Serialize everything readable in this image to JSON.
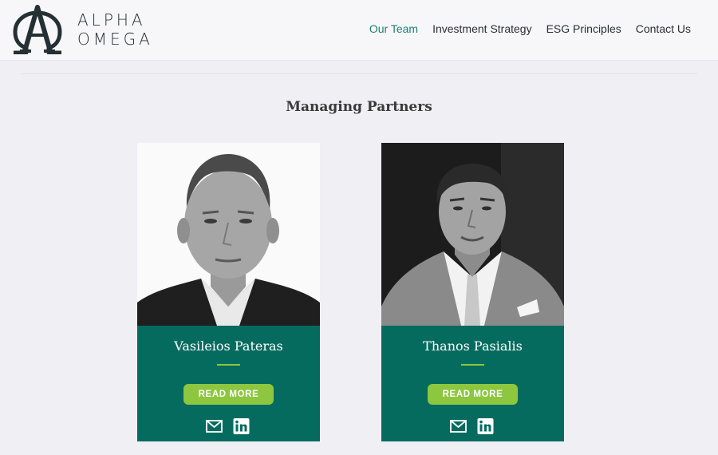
{
  "brand": {
    "line1": "ALPHA",
    "line2": "OMEGA"
  },
  "nav": {
    "items": [
      {
        "label": "Our Team",
        "active": true
      },
      {
        "label": "Investment Strategy",
        "active": false
      },
      {
        "label": "ESG Principles",
        "active": false
      },
      {
        "label": "Contact Us",
        "active": false
      }
    ]
  },
  "section": {
    "title": "Managing Partners"
  },
  "partners": [
    {
      "name": "Vasileios Pateras",
      "button": "READ MORE"
    },
    {
      "name": "Thanos Pasialis",
      "button": "READ MORE"
    }
  ],
  "colors": {
    "accent": "#1e7d74",
    "panel": "#066b5f",
    "button": "#8dc63f",
    "logo": "#243033"
  },
  "icons": [
    "alpha-omega-logo-icon",
    "mail-icon",
    "linkedin-icon"
  ]
}
